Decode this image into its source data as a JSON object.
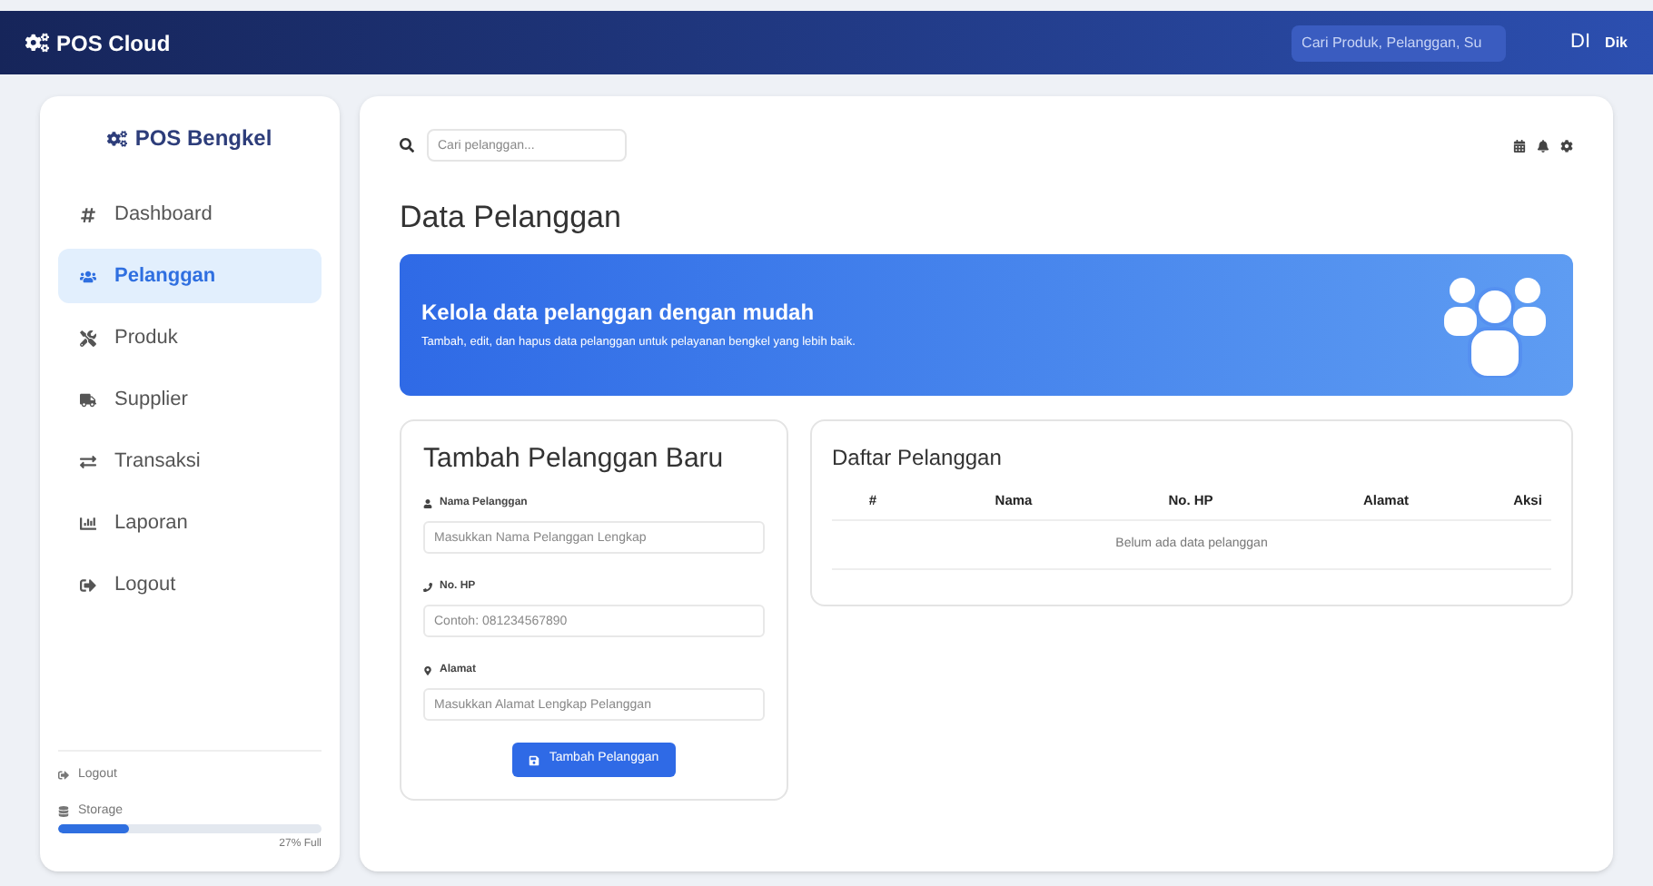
{
  "topbar": {
    "brand": "POS Cloud",
    "search": {
      "placeholder": "Cari Produk, Pelanggan, Su"
    },
    "user_initials": "DI",
    "user_name": "Dik"
  },
  "sidebar": {
    "brand": "POS Bengkel",
    "items": [
      {
        "label": "Dashboard",
        "selected": false
      },
      {
        "label": "Pelanggan",
        "selected": true
      },
      {
        "label": "Produk",
        "selected": false
      },
      {
        "label": "Supplier",
        "selected": false
      },
      {
        "label": "Transaksi",
        "selected": false
      },
      {
        "label": "Laporan",
        "selected": false
      },
      {
        "label": "Logout",
        "selected": false
      }
    ],
    "footer_logout": "Logout",
    "storage": {
      "label": "Storage",
      "level": 0.27,
      "reading": "27% Full"
    }
  },
  "main": {
    "search": {
      "placeholder": "Cari pelanggan..."
    },
    "title": "Data Pelanggan",
    "banner": {
      "heading": "Kelola data pelanggan dengan mudah",
      "text": "Tambah, edit, dan hapus data pelanggan untuk pelayanan bengkel yang lebih baik."
    },
    "form": {
      "title": "Tambah Pelanggan Baru",
      "fields": [
        {
          "label": "Nama Pelanggan",
          "placeholder": "Masukkan Nama Pelanggan Lengkap"
        },
        {
          "label": "No. HP",
          "placeholder": "Contoh: 081234567890"
        },
        {
          "label": "Alamat",
          "placeholder": "Masukkan Alamat Lengkap Pelanggan"
        }
      ],
      "submit": "Tambah Pelanggan"
    },
    "table": {
      "title": "Daftar Pelanggan",
      "columns": [
        "#",
        "Nama",
        "No. HP",
        "Alamat",
        "Aksi"
      ],
      "empty": "Belum ada data pelanggan"
    }
  }
}
